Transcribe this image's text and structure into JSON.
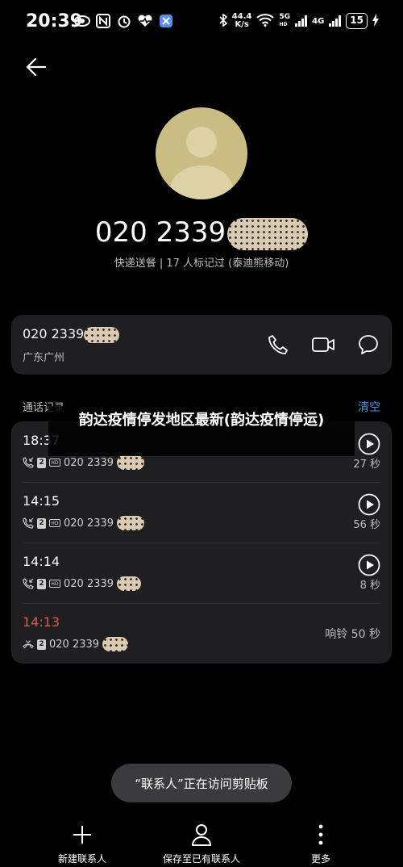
{
  "status_bar": {
    "time": "20:39",
    "net_speed_value": "44.4",
    "net_speed_unit": "K/s",
    "sig1_label": "5G",
    "sig1_sub": "HD",
    "sig2_label": "4G",
    "battery": "15"
  },
  "contact": {
    "number": "020 2339",
    "subtitle": "快递送餐 | 17 人标记过 (泰迪熊移动)"
  },
  "number_card": {
    "number": "020 2339",
    "location": "广东广州"
  },
  "call_log": {
    "section_label": "通话记录",
    "clear_label": "清空",
    "entries": [
      {
        "time": "18:37",
        "number": "020 2339",
        "duration": "27 秒"
      },
      {
        "time": "14:15",
        "number": "020 2339",
        "duration": "56 秒"
      },
      {
        "time": "14:14",
        "number": "020 2339",
        "duration": "8 秒"
      },
      {
        "time": "14:13",
        "number": "020 2339",
        "duration": "响铃 50 秒"
      }
    ],
    "sim": "2"
  },
  "overlay_text": "韵达疫情停发地区最新(韵达疫情停运)",
  "toast": "“联系人”正在访问剪贴板",
  "bottom_bar": {
    "new_contact": "新建联系人",
    "save_existing": "保存至已有联系人",
    "more": "更多"
  },
  "colors": {
    "background": "#000000",
    "card": "#1f1f21",
    "accent": "#4a90e2",
    "missed": "#e8534a",
    "avatar": "#c9bd83"
  }
}
